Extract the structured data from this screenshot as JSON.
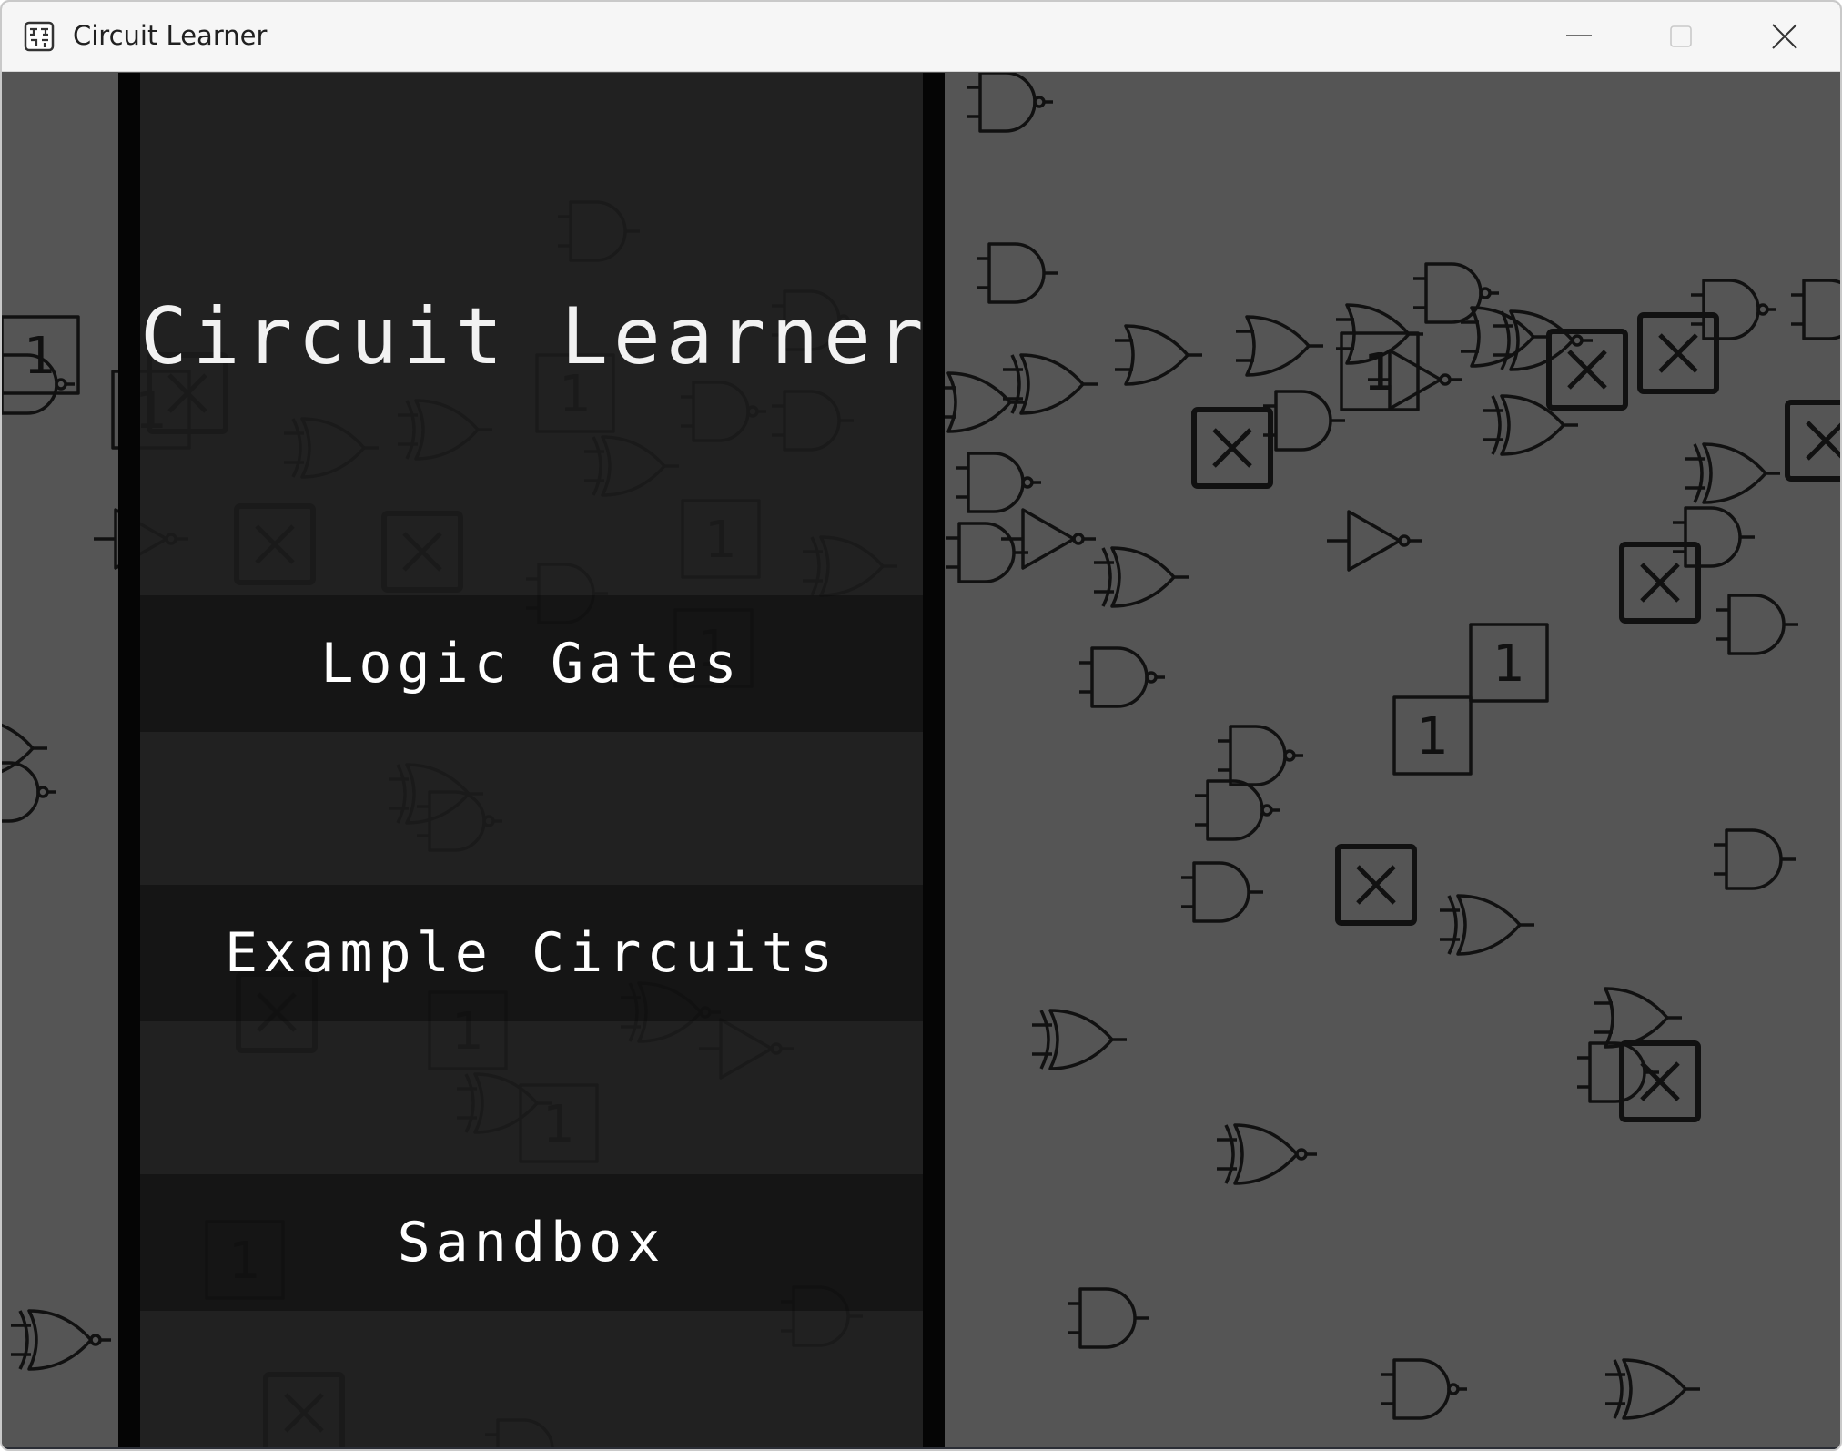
{
  "window": {
    "title": "Circuit Learner",
    "icon": "circuit-app-icon",
    "controls": {
      "minimize": "minimize-icon",
      "maximize": "maximize-icon",
      "close": "close-icon"
    }
  },
  "menu": {
    "title": "Circuit Learner",
    "buttons": [
      {
        "label": "Logic Gates"
      },
      {
        "label": "Example Circuits"
      },
      {
        "label": "Sandbox"
      }
    ]
  },
  "background": {
    "symbols": [
      "and-gate",
      "nand-gate",
      "or-gate",
      "xor-gate",
      "xnor-gate",
      "not-gate",
      "constant-one-box",
      "x-box"
    ],
    "box_label": "1"
  },
  "colors": {
    "titlebar": "#f6f6f6",
    "background": "#555555",
    "panel": "#1c1c1c",
    "panel_border": "#050505",
    "text": "#ffffff",
    "symbol_stroke": "#111111"
  }
}
